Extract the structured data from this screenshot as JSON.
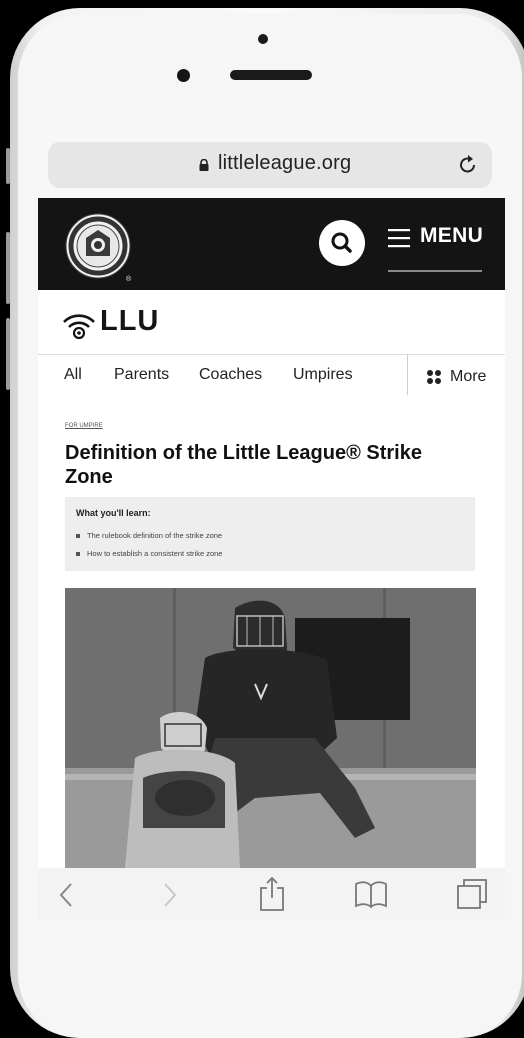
{
  "browser": {
    "url": "littleleague.org",
    "lock_icon": "lock-icon",
    "reload_icon": "reload-icon"
  },
  "site_header": {
    "logo": "little-league-logo",
    "search_icon": "search-icon",
    "menu_label": "MENU"
  },
  "brand": {
    "name": "LLU"
  },
  "tabs": [
    {
      "label": "All"
    },
    {
      "label": "Parents"
    },
    {
      "label": "Coaches"
    },
    {
      "label": "Umpires"
    }
  ],
  "more_label": "More",
  "article": {
    "kicker": "FOR UMPIRE",
    "title": "Definition of the Little League® Strike Zone",
    "learn_title": "What you'll learn:",
    "learn_items": [
      "The rulebook definition of the strike zone",
      "How to establish a consistent strike zone"
    ]
  },
  "bottom_toolbar": {
    "icons": [
      "back-icon",
      "forward-icon",
      "share-icon",
      "bookmarks-icon",
      "tabs-icon"
    ]
  }
}
